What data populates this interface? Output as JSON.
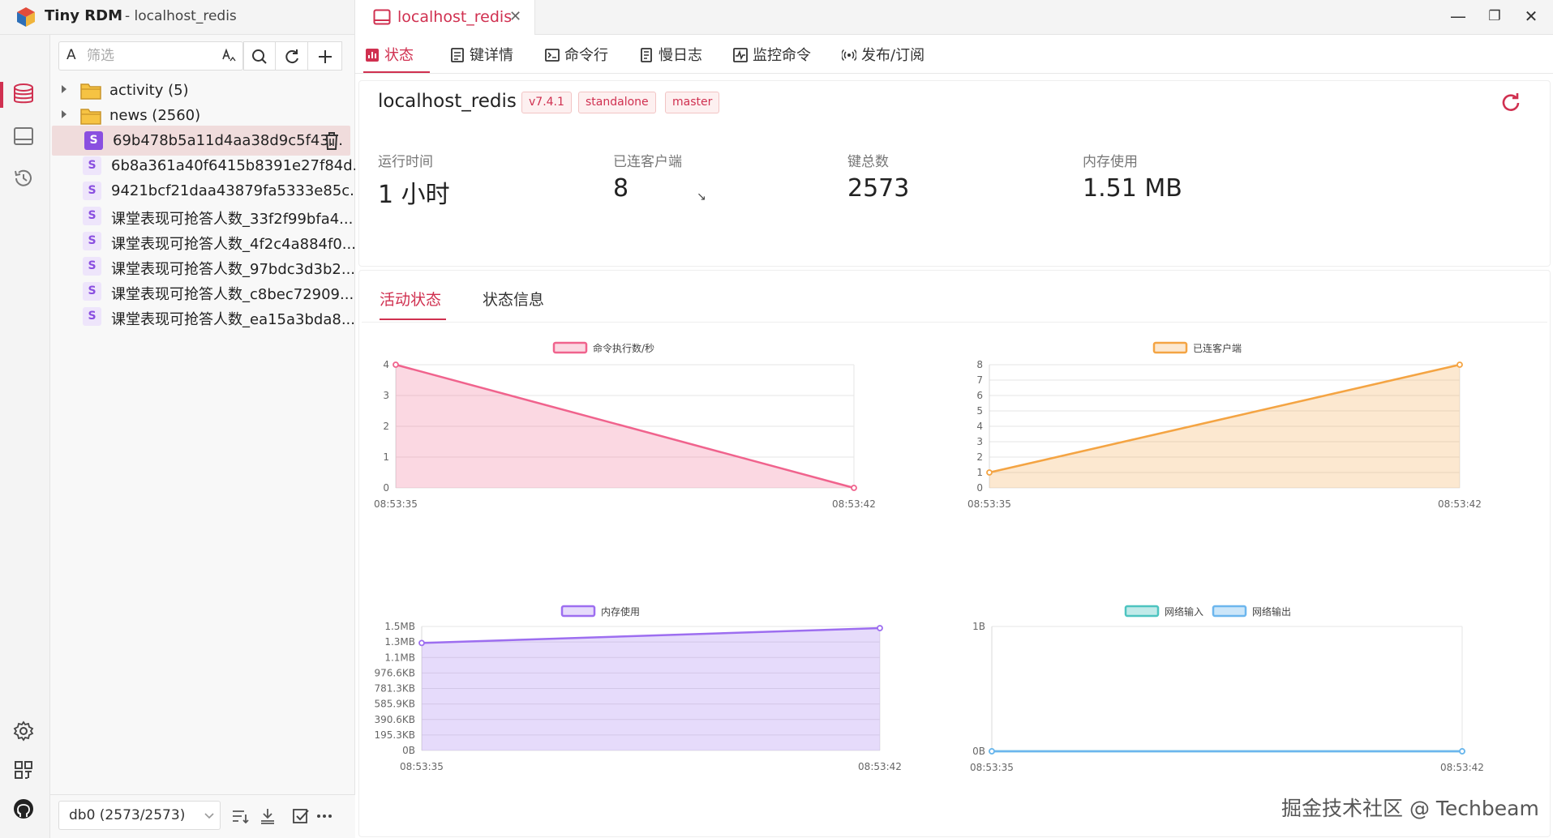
{
  "app": {
    "name": "Tiny RDM",
    "subtitle": "- localhost_redis"
  },
  "connection_tab": {
    "label": "localhost_redis"
  },
  "window_controls": {
    "minimize": "—",
    "maximize": "❐",
    "close": "✕"
  },
  "sidebar": {
    "filter_placeholder": "筛选",
    "filter_prefix": "A",
    "tree": [
      {
        "type": "folder",
        "label": "activity (5)"
      },
      {
        "type": "folder",
        "label": "news (2560)"
      },
      {
        "type": "key",
        "badge": "S",
        "label": "69b478b5a11d4aa38d9c5f43...",
        "selected": true
      },
      {
        "type": "key",
        "badge": "S",
        "label": "6b8a361a40f6415b8391e27f84d..."
      },
      {
        "type": "key",
        "badge": "S",
        "label": "9421bcf21daa43879fa5333e85c..."
      },
      {
        "type": "key",
        "badge": "S",
        "label": "课堂表现可抢答人数_33f2f99bfa4..."
      },
      {
        "type": "key",
        "badge": "S",
        "label": "课堂表现可抢答人数_4f2c4a884f0..."
      },
      {
        "type": "key",
        "badge": "S",
        "label": "课堂表现可抢答人数_97bdc3d3b2..."
      },
      {
        "type": "key",
        "badge": "S",
        "label": "课堂表现可抢答人数_c8bec72909..."
      },
      {
        "type": "key",
        "badge": "S",
        "label": "课堂表现可抢答人数_ea15a3bda8..."
      }
    ],
    "db_select": "db0 (2573/2573)"
  },
  "subtabs": [
    {
      "label": "状态",
      "icon": "chart-icon",
      "active": true
    },
    {
      "label": "键详情",
      "icon": "detail-icon"
    },
    {
      "label": "命令行",
      "icon": "terminal-icon"
    },
    {
      "label": "慢日志",
      "icon": "log-icon"
    },
    {
      "label": "监控命令",
      "icon": "monitor-icon"
    },
    {
      "label": "发布/订阅",
      "icon": "broadcast-icon"
    }
  ],
  "server": {
    "name": "localhost_redis",
    "tags": [
      "v7.4.1",
      "standalone",
      "master"
    ],
    "stats": [
      {
        "label": "运行时间",
        "value": "1 小时"
      },
      {
        "label": "已连客户端",
        "value": "8",
        "trend": "↘"
      },
      {
        "label": "键总数",
        "value": "2573"
      },
      {
        "label": "内存使用",
        "value": "1.51 MB"
      }
    ]
  },
  "inner_tabs": [
    {
      "label": "活动状态",
      "active": true
    },
    {
      "label": "状态信息"
    }
  ],
  "colors": {
    "accent": "#d03050",
    "pink": "#f0638d",
    "orange": "#f4a443",
    "purple": "#9d6ef0",
    "teal": "#4dc4c0",
    "blue": "#6cb6ee"
  },
  "chart_data": [
    {
      "type": "area",
      "legend": [
        "命令执行数/秒"
      ],
      "x": [
        "08:53:35",
        "08:53:42"
      ],
      "series": [
        {
          "name": "命令执行数/秒",
          "values": [
            4,
            0
          ]
        }
      ],
      "yticks": [
        "0",
        "1",
        "2",
        "3",
        "4"
      ],
      "ylim": [
        0,
        4
      ]
    },
    {
      "type": "area",
      "legend": [
        "已连客户端"
      ],
      "x": [
        "08:53:35",
        "08:53:42"
      ],
      "series": [
        {
          "name": "已连客户端",
          "values": [
            1,
            8
          ]
        }
      ],
      "yticks": [
        "0",
        "1",
        "2",
        "3",
        "4",
        "5",
        "6",
        "7",
        "8"
      ],
      "ylim": [
        0,
        8
      ]
    },
    {
      "type": "area",
      "legend": [
        "内存使用"
      ],
      "x": [
        "08:53:35",
        "08:53:42"
      ],
      "series": [
        {
          "name": "内存使用",
          "values": [
            1.3,
            1.48
          ]
        }
      ],
      "yticks": [
        "0B",
        "195.3KB",
        "390.6KB",
        "585.9KB",
        "781.3KB",
        "976.6KB",
        "1.1MB",
        "1.3MB",
        "1.5MB"
      ],
      "ylim": [
        0,
        1.5
      ]
    },
    {
      "type": "line",
      "legend": [
        "网络输入",
        "网络输出"
      ],
      "x": [
        "08:53:35",
        "08:53:42"
      ],
      "series": [
        {
          "name": "网络输入",
          "values": [
            0,
            0
          ]
        },
        {
          "name": "网络输出",
          "values": [
            0,
            0
          ]
        }
      ],
      "yticks": [
        "0B",
        "1B"
      ],
      "ylim": [
        0,
        1
      ]
    }
  ],
  "watermark": "掘金技术社区 @ Techbeam"
}
